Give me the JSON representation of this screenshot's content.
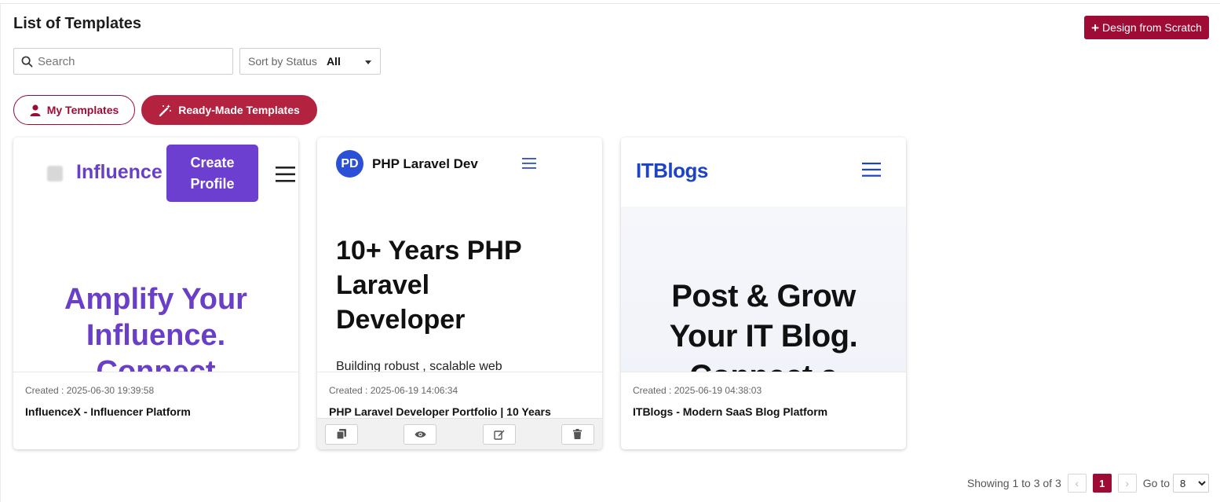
{
  "header": {
    "title": "List of Templates",
    "design_button_label": "Design from Scratch"
  },
  "filters": {
    "search_placeholder": "Search",
    "sort_label": "Sort by Status",
    "sort_value": "All"
  },
  "tabs": [
    {
      "label": "My Templates",
      "icon": "user-icon",
      "active": false
    },
    {
      "label": "Ready-Made Templates",
      "icon": "magic-wand-icon",
      "active": true
    }
  ],
  "templates": [
    {
      "created": "Created : 2025-06-30 19:39:58",
      "name": "InfluenceX - Influencer Platform",
      "preview": {
        "brand": "Influence",
        "cta": "Create Profile",
        "hero": "Amplify Your\nInfluence.\nConnect"
      }
    },
    {
      "created": "Created : 2025-06-19 14:06:34",
      "name": "PHP Laravel Developer Portfolio | 10 Years",
      "preview": {
        "avatar": "PD",
        "brand": "PHP Laravel Dev",
        "hero": "10+ Years PHP\nLaravel\nDeveloper",
        "sub": "Building  robust , scalable  web"
      }
    },
    {
      "created": "Created : 2025-06-19 04:38:03",
      "name": "ITBlogs - Modern SaaS Blog Platform",
      "preview": {
        "brand": "ITBlogs",
        "hero": "Post & Grow\nYour IT Blog.\nConnect a"
      }
    }
  ],
  "card_actions": [
    "copy-icon",
    "eye-icon",
    "edit-icon",
    "trash-icon"
  ],
  "pagination": {
    "showing": "Showing 1 to 3 of 3",
    "current_page": "1",
    "goto_label": "Go to",
    "goto_value": "8"
  },
  "colors": {
    "primary": "#9e0b34",
    "ready_tab": "#b3223f",
    "influence_purple": "#6a3fc8",
    "itblogs_blue": "#1d44c8"
  }
}
